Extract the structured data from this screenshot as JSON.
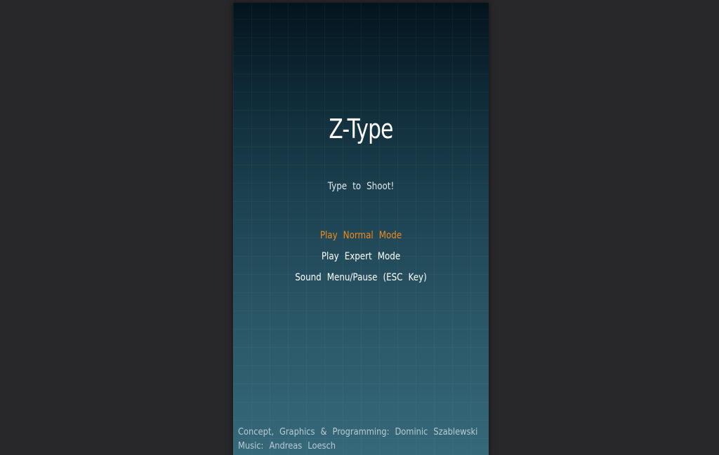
{
  "game": {
    "title": "Z-Type",
    "subtitle": "Type to Shoot!"
  },
  "menu": {
    "items": [
      {
        "label": "Play Normal Mode",
        "selected": true
      },
      {
        "label": "Play Expert Mode",
        "selected": false
      },
      {
        "label": "Sound Menu/Pause (ESC Key)",
        "selected": false
      }
    ]
  },
  "credits": {
    "line1": "Concept, Graphics & Programming: Dominic Szablewski",
    "line2": "Music: Andreas Loesch"
  },
  "colors": {
    "page_background": "#28282a",
    "selected_item": "#f28a1c",
    "menu_text": "#ffffff",
    "credits_text": "#b9cbd3"
  }
}
